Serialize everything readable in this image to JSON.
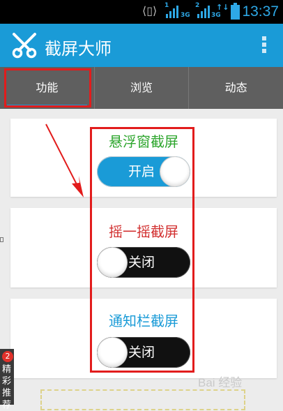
{
  "status_bar": {
    "sim1_index": "1",
    "sim1_net": "3G",
    "sim2_index": "2",
    "sim2_net": "3G",
    "time": "13:37",
    "icons": [
      "vibrate-icon",
      "signal-icon",
      "signal-icon",
      "data-transfer-icon",
      "battery-icon"
    ]
  },
  "app_bar": {
    "title": "截屏大师",
    "logo_icon": "scissors-icon",
    "menu_icon": "overflow-menu-icon"
  },
  "tabs": [
    {
      "label": "功能",
      "active": true
    },
    {
      "label": "浏览",
      "active": false
    },
    {
      "label": "动态",
      "active": false
    }
  ],
  "features": [
    {
      "label": "悬浮窗截屏",
      "toggle_text": "开启",
      "state": "on",
      "label_color": "#2ca52c"
    },
    {
      "label": "摇一摇截屏",
      "toggle_text": "关闭",
      "state": "off",
      "label_color": "#d23030"
    },
    {
      "label": "通知栏截屏",
      "toggle_text": "关闭",
      "state": "off",
      "label_color": "#1a9bd7"
    }
  ],
  "promo": {
    "badge_count": "2",
    "text": "精彩推荐"
  },
  "watermark": "Bai 经验",
  "colors": {
    "accent": "#1a9bd7",
    "annotation": "#e21c1c"
  }
}
